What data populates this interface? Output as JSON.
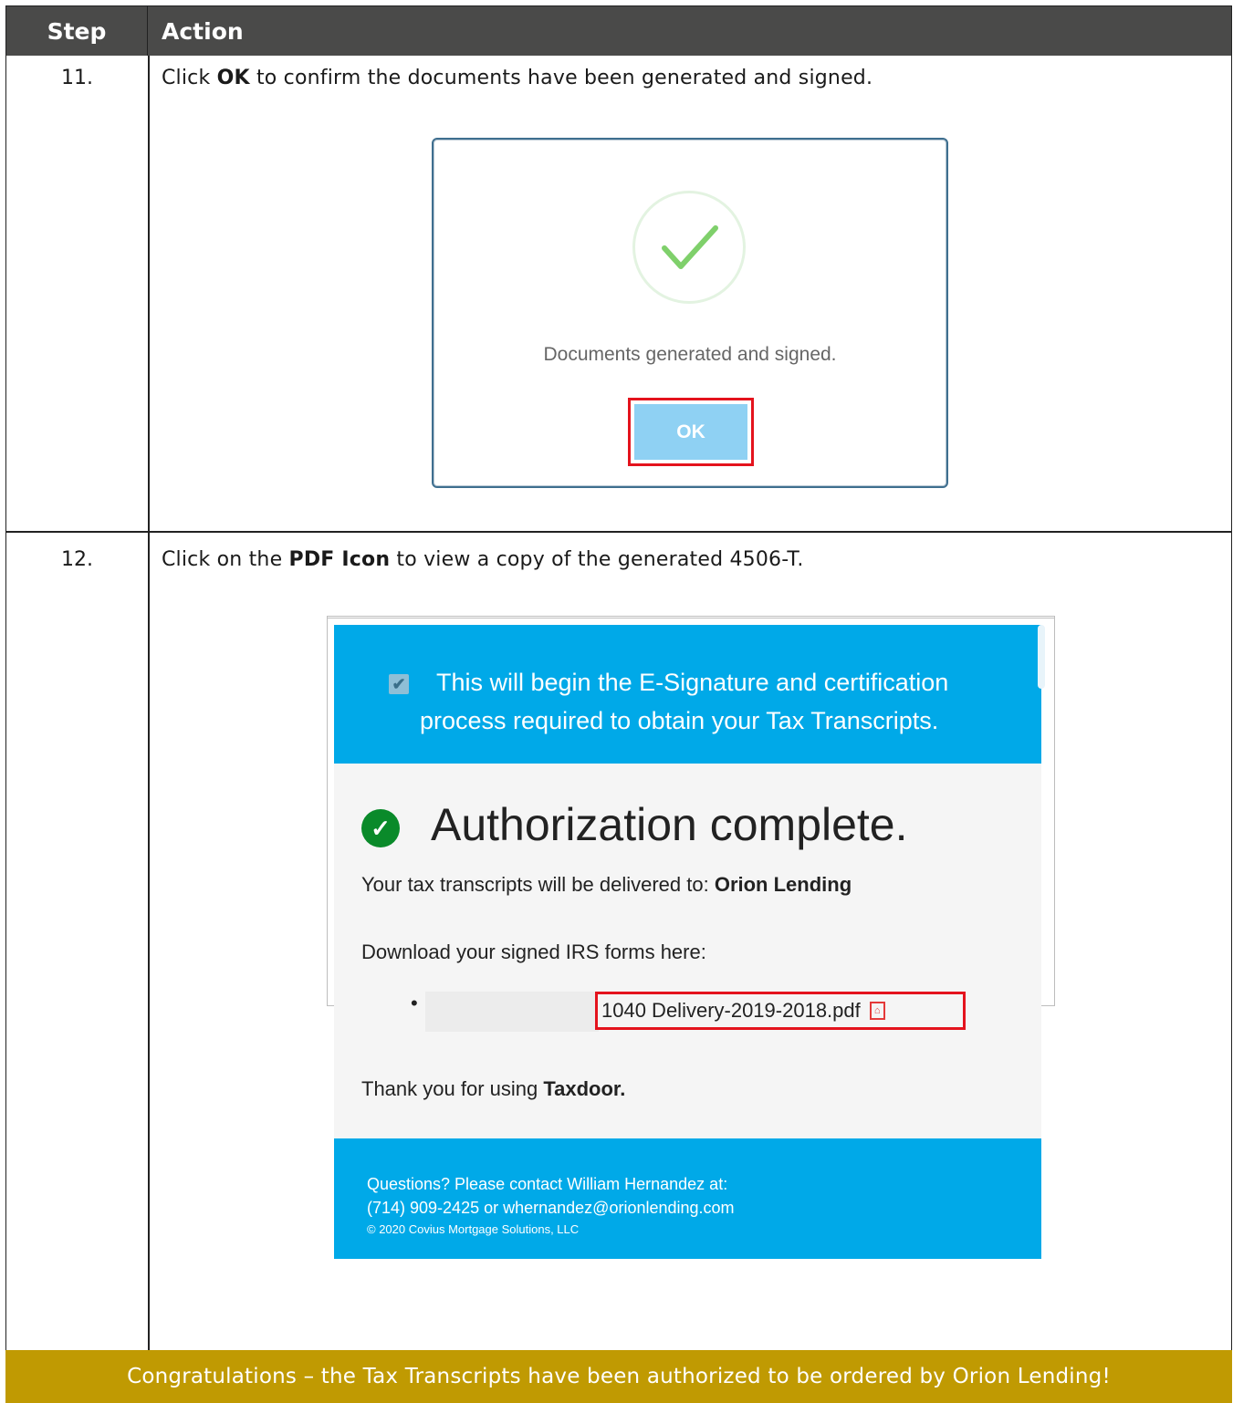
{
  "table": {
    "header": {
      "step": "Step",
      "action": "Action"
    }
  },
  "steps": [
    {
      "number": "11.",
      "prefix": "Click ",
      "bold": "OK",
      "suffix": " to confirm the documents have been generated and signed.",
      "dialog": {
        "message": "Documents generated and signed.",
        "ok_label": "OK"
      }
    },
    {
      "number": "12.",
      "prefix": "Click on the ",
      "bold": "PDF Icon",
      "suffix": " to view a copy of the generated 4506-T.",
      "auth": {
        "banner_line1": "This will begin the E-Signature and certification",
        "banner_line2": "process required to obtain your Tax Transcripts.",
        "title": "Authorization complete.",
        "delivered_prefix": "Your tax transcripts will be delivered to: ",
        "delivered_to": "Orion Lending",
        "download_text": "Download your signed IRS forms here:",
        "file_name": "1040 Delivery-2019-2018.pdf",
        "thanks_prefix": "Thank you for using ",
        "thanks_brand": "Taxdoor.",
        "footer_line1": "Questions? Please contact William Hernandez at:",
        "footer_line2": "(714) 909-2425 or whernandez@orionlending.com",
        "footer_line3": "© 2020 Covius Mortgage Solutions, LLC"
      }
    }
  ],
  "congrats": "Congratulations – the Tax Transcripts have been authorized to be ordered by Orion Lending!",
  "colors": {
    "header_bg": "#4a4a49",
    "congrats_bg": "#c09a02",
    "highlight": "#e4131d",
    "banner": "#00a9e8"
  },
  "icons": [
    "check-icon",
    "checkbox-icon",
    "check-circle-icon",
    "pdf-icon"
  ]
}
